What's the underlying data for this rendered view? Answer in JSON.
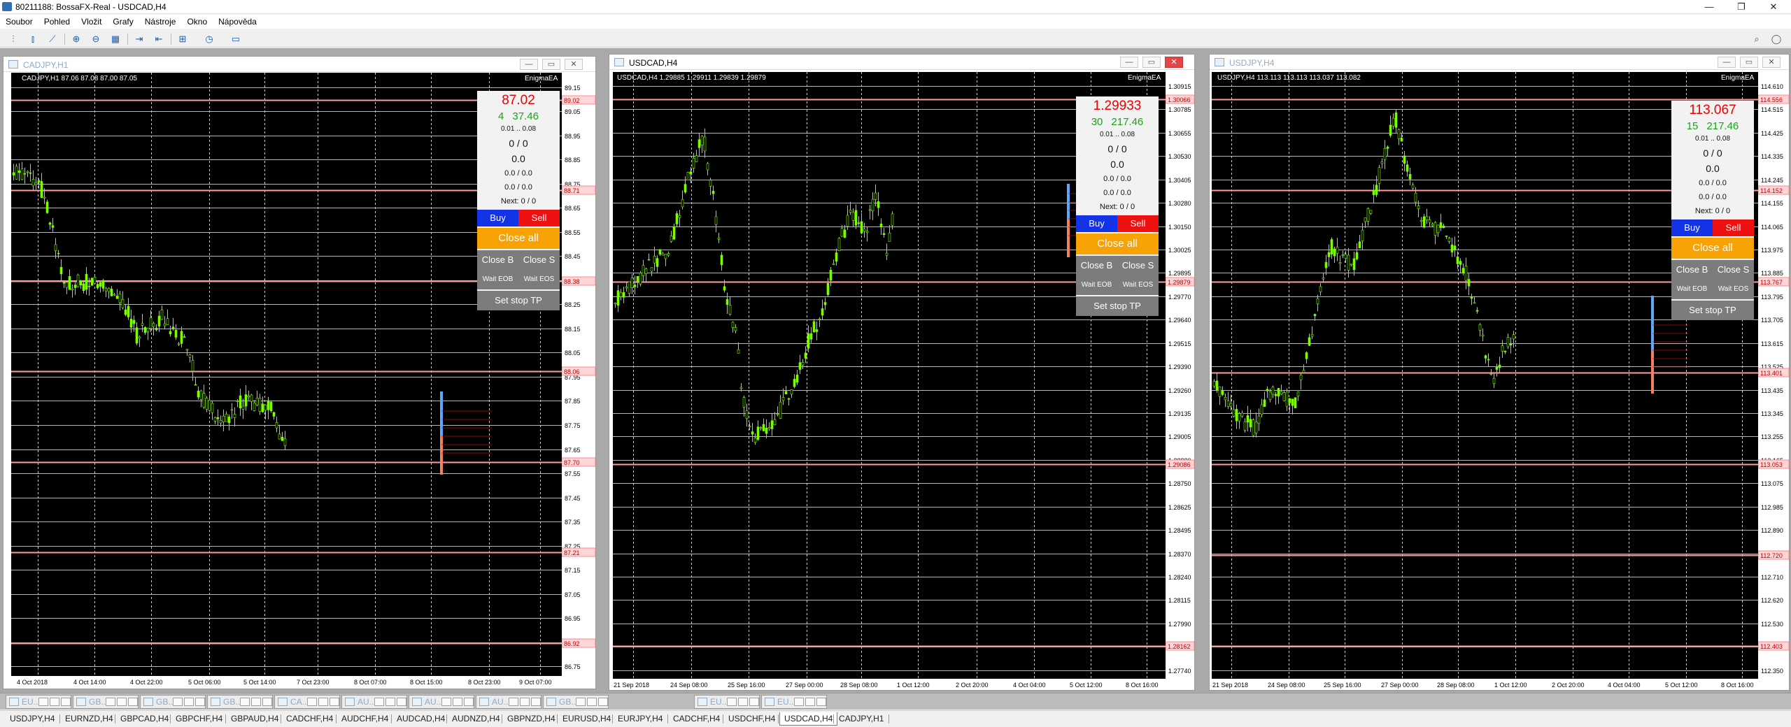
{
  "window": {
    "title": "80211188: BossaFX-Real - USDCAD,H4",
    "controls": {
      "minimize": "—",
      "maximize": "❐",
      "close": "✕"
    }
  },
  "menu": [
    "Soubor",
    "Pohled",
    "Vložit",
    "Grafy",
    "Nástroje",
    "Okno",
    "Nápověda"
  ],
  "toolbar_icons": [
    "bar-chart-icon",
    "candlestick-icon",
    "line-chart-icon",
    "zoom-in-icon",
    "zoom-out-icon",
    "tile-windows-icon",
    "autoscroll-icon",
    "chart-shift-icon",
    "indicators-icon",
    "periods-icon",
    "templates-icon"
  ],
  "charts": [
    {
      "id": "cadjpy",
      "title": "CADJPY,H1",
      "header": "CADJPY,H1  87.06 87.08 87.00 87.05",
      "ea_label": "EnigmaEA",
      "panel": {
        "price": "87.02",
        "count": "4",
        "profit": "37.46",
        "lots": "0.01 .. 0.08",
        "ratio": "0 / 0",
        "value": "0.0",
        "pair1": "0.0 / 0.0",
        "pair2": "0.0 / 0.0",
        "next": "Next: 0 / 0",
        "buy": "Buy",
        "sell": "Sell",
        "close_all": "Close all",
        "close_b": "Close B",
        "close_s": "Close S",
        "wait_eob": "Wait EOB",
        "wait_eos": "Wait EOS",
        "set_stop": "Set stop TP"
      },
      "ylabels": [
        "89.15",
        "89.05",
        "88.95",
        "88.85",
        "88.75",
        "88.65",
        "88.55",
        "88.45",
        "88.35",
        "88.25",
        "88.15",
        "88.05",
        "87.95",
        "87.85",
        "87.75",
        "87.65",
        "87.55",
        "87.45",
        "87.35",
        "87.25",
        "87.15",
        "87.05",
        "86.95",
        "86.85",
        "86.75"
      ],
      "hl_labels": [
        "89.02",
        "88.71",
        "88.38",
        "88.06",
        "87.70",
        "87.21",
        "86.92"
      ],
      "xlabels": [
        "4 Oct 2018",
        "4 Oct 14:00",
        "4 Oct 22:00",
        "5 Oct 06:00",
        "5 Oct 14:00",
        "7 Oct 23:00",
        "8 Oct 07:00",
        "8 Oct 15:00",
        "8 Oct 23:00",
        "9 Oct 07:00"
      ]
    },
    {
      "id": "usdcad",
      "title": "USDCAD,H4",
      "header": "USDCAD,H4  1.29885 1.29911 1.29839 1.29879",
      "ea_label": "EnigmaEA",
      "panel": {
        "price": "1.29933",
        "count": "30",
        "profit": "217.46",
        "lots": "0.01 .. 0.08",
        "ratio": "0 / 0",
        "value": "0.0",
        "pair1": "0.0 / 0.0",
        "pair2": "0.0 / 0.0",
        "next": "Next: 0 / 0",
        "buy": "Buy",
        "sell": "Sell",
        "close_all": "Close all",
        "close_b": "Close B",
        "close_s": "Close S",
        "wait_eob": "Wait EOB",
        "wait_eos": "Wait EOS",
        "set_stop": "Set stop TP"
      },
      "ylabels": [
        "1.30915",
        "1.30785",
        "1.30655",
        "1.30530",
        "1.30405",
        "1.30280",
        "1.30150",
        "1.30025",
        "1.29895",
        "1.29770",
        "1.29640",
        "1.29515",
        "1.29390",
        "1.29260",
        "1.29135",
        "1.29005",
        "1.28880",
        "1.28750",
        "1.28625",
        "1.28495",
        "1.28370",
        "1.28240",
        "1.28115",
        "1.27990",
        "1.27865",
        "1.27740"
      ],
      "hl_labels": [
        "1.30066",
        "1.29879",
        "1.29086",
        "1.28162"
      ],
      "xlabels": [
        "21 Sep 2018",
        "24 Sep 08:00",
        "25 Sep 16:00",
        "27 Sep 00:00",
        "28 Sep 08:00",
        "1 Oct 12:00",
        "2 Oct 20:00",
        "4 Oct 04:00",
        "5 Oct 12:00",
        "8 Oct 16:00"
      ]
    },
    {
      "id": "usdjpy",
      "title": "USDJPY,H4",
      "header": "USDJPY,H4  113.113 113.113 113.037 113.082",
      "ea_label": "EnigmaEA",
      "panel": {
        "price": "113.067",
        "count": "15",
        "profit": "217.46",
        "lots": "0.01 .. 0.08",
        "ratio": "0 / 0",
        "value": "0.0",
        "pair1": "0.0 / 0.0",
        "pair2": "0.0 / 0.0",
        "next": "Next: 0 / 0",
        "buy": "Buy",
        "sell": "Sell",
        "close_all": "Close all",
        "close_b": "Close B",
        "close_s": "Close S",
        "wait_eob": "Wait EOB",
        "wait_eos": "Wait EOS",
        "set_stop": "Set stop TP"
      },
      "ylabels": [
        "114.610",
        "114.515",
        "114.425",
        "114.335",
        "114.245",
        "114.155",
        "114.065",
        "113.975",
        "113.885",
        "113.795",
        "113.705",
        "113.615",
        "113.525",
        "113.435",
        "113.345",
        "113.255",
        "113.165",
        "113.075",
        "112.985",
        "112.890",
        "112.800",
        "112.710",
        "112.620",
        "112.530",
        "112.440",
        "112.350"
      ],
      "hl_labels": [
        "114.556",
        "114.152",
        "113.767",
        "113.401",
        "113.053",
        "112.720",
        "112.403"
      ],
      "xlabels": [
        "21 Sep 2018",
        "24 Sep 08:00",
        "25 Sep 16:00",
        "27 Sep 00:00",
        "28 Sep 08:00",
        "1 Oct 12:00",
        "2 Oct 20:00",
        "4 Oct 04:00",
        "5 Oct 12:00",
        "8 Oct 16:00"
      ]
    }
  ],
  "minimized": [
    "EU...",
    "GB...",
    "GB...",
    "GB...",
    "CA...",
    "AU...",
    "AU...",
    "AU...",
    "GB...",
    "EU...",
    "EU..."
  ],
  "symbol_tabs": [
    "USDJPY,H4",
    "EURNZD,H4",
    "GBPCAD,H4",
    "GBPCHF,H4",
    "GBPAUD,H4",
    "CADCHF,H4",
    "AUDCHF,H4",
    "AUDCAD,H4",
    "AUDNZD,H4",
    "GBPNZD,H4",
    "EURUSD,H4",
    "EURJPY,H4",
    "CADCHF,H4",
    "USDCHF,H4",
    "USDCAD,H4",
    "CADJPY,H1"
  ],
  "active_symbol_tab": "USDCAD,H4",
  "colors": {
    "chart_bg": "#000000",
    "candle": "#7cfc00",
    "grid": "#cfcfcf",
    "hline": "#ff9aa0",
    "buy": "#1433e6",
    "sell": "#ee1111",
    "close_all": "#f8a206",
    "panel_gray": "#7c7c7c"
  }
}
